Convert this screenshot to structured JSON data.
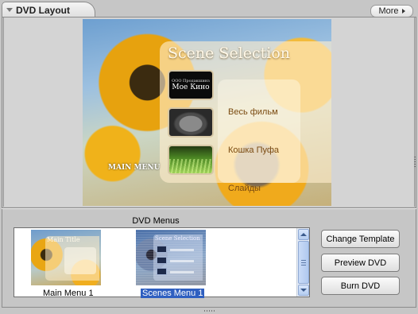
{
  "panel": {
    "title": "DVD Layout",
    "more_label": "More"
  },
  "preview": {
    "scene_title": "Scene Selection",
    "main_menu_label": "MAIN MENU",
    "thumb1_small_text": "ООО Продакшинз",
    "thumb1_big_text": "Мое Кино",
    "items": [
      {
        "label": "Весь фильм",
        "thumb": "title-card"
      },
      {
        "label": "Кошка Пуфа",
        "thumb": "cat"
      },
      {
        "label": "Слайды",
        "thumb": "grass"
      }
    ]
  },
  "menus": {
    "caption": "DVD Menus",
    "thumb1_title": "Main Title",
    "thumb2_title": "Scene Selection",
    "items": [
      {
        "name": "Main Menu 1",
        "selected": false
      },
      {
        "name": "Scenes Menu 1",
        "selected": true
      }
    ]
  },
  "buttons": {
    "change_template": "Change Template",
    "preview_dvd": "Preview DVD",
    "burn_dvd": "Burn DVD"
  },
  "colors": {
    "selection": "#2f5fc0",
    "panel_bg": "#c6c6c6",
    "item_text": "#7a4a10"
  }
}
